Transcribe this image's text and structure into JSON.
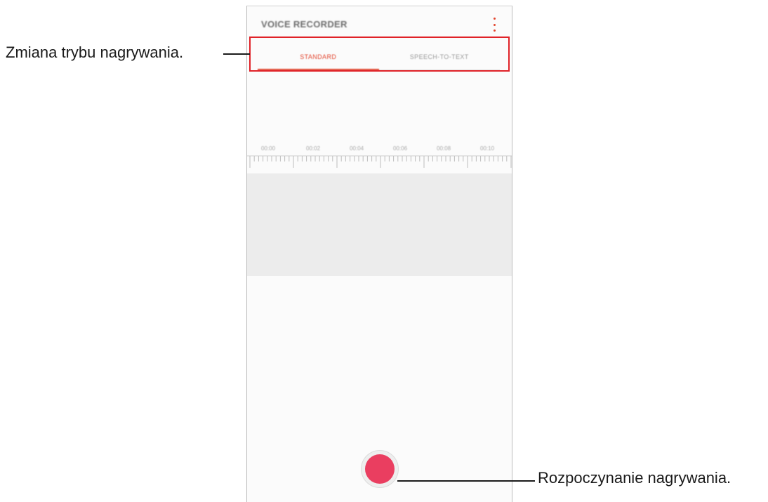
{
  "app": {
    "title": "VOICE RECORDER"
  },
  "tabs": [
    {
      "label": "STANDARD",
      "active": true
    },
    {
      "label": "SPEECH-TO-TEXT",
      "active": false
    }
  ],
  "timeline": {
    "labels": [
      "00:00",
      "00:02",
      "00:04",
      "00:06",
      "00:08",
      "00:10"
    ]
  },
  "record_button": {
    "icon": "record-icon"
  },
  "callouts": {
    "mode": "Zmiana trybu nagrywania.",
    "record": "Rozpoczynanie nagrywania."
  },
  "colors": {
    "accent": "#e2452e",
    "record": "#ea3e60",
    "highlight": "#e02228"
  }
}
